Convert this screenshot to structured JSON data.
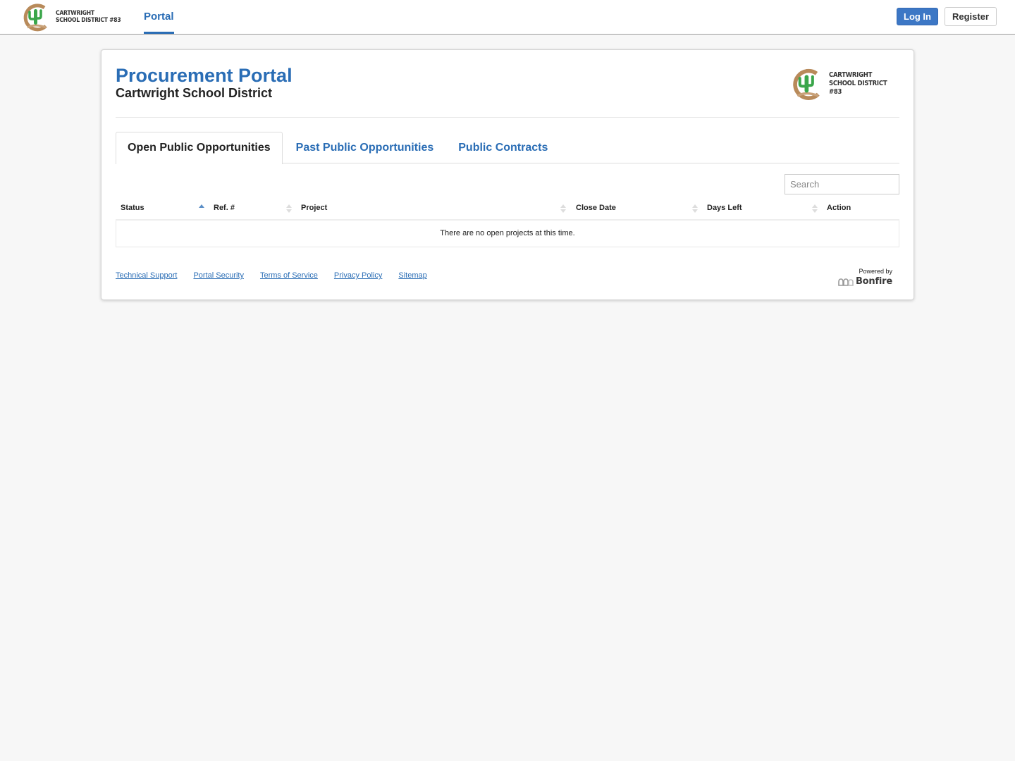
{
  "topbar": {
    "brand_line1": "Cartwright",
    "brand_line2": "School District #83",
    "nav_portal": "Portal",
    "login_label": "Log In",
    "register_label": "Register"
  },
  "header": {
    "title": "Procurement Portal",
    "subtitle": "Cartwright School District",
    "logo_line1": "Cartwright",
    "logo_line2": "School District #83"
  },
  "tabs": [
    {
      "label": "Open Public Opportunities",
      "active": true
    },
    {
      "label": "Past Public Opportunities",
      "active": false
    },
    {
      "label": "Public Contracts",
      "active": false
    }
  ],
  "search": {
    "placeholder": "Search",
    "value": ""
  },
  "table": {
    "columns": [
      {
        "label": "Status",
        "sort": "asc"
      },
      {
        "label": "Ref. #",
        "sort": "none"
      },
      {
        "label": "Project",
        "sort": "none"
      },
      {
        "label": "Close Date",
        "sort": "none"
      },
      {
        "label": "Days Left",
        "sort": "none"
      },
      {
        "label": "Action",
        "sort": "none"
      }
    ],
    "empty_message": "There are no open projects at this time."
  },
  "footer": {
    "links": [
      "Technical Support",
      "Portal Security",
      "Terms of Service",
      "Privacy Policy",
      "Sitemap"
    ],
    "powered_by": "Powered by",
    "powered_brand": "Bonfire"
  },
  "colors": {
    "accent": "#2a6db5",
    "login_button": "#3c77c5",
    "background": "#f7f7f7",
    "sort_active": "#5b8fc7"
  },
  "icons": {
    "brand_logo": "cactus-logo-icon",
    "sort_asc": "sort-ascending-icon",
    "sort_none": "sort-unsorted-icon",
    "bonfire_logo": "bonfire-flame-icon"
  }
}
